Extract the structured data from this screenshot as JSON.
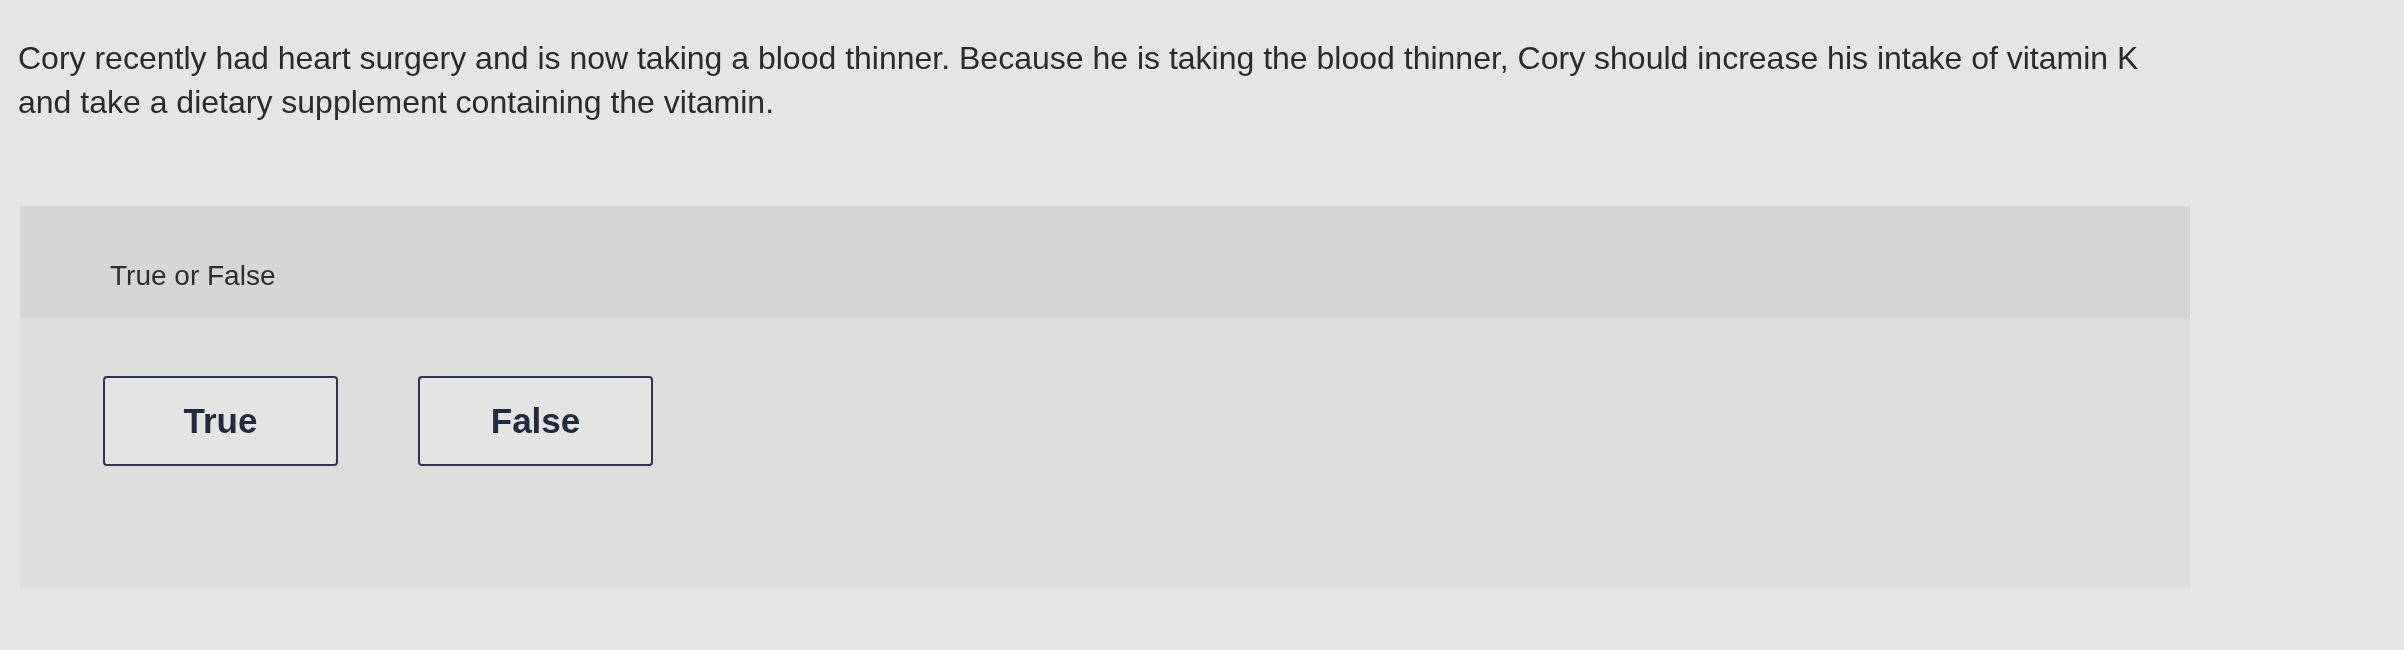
{
  "question": {
    "text": "Cory recently had heart surgery and is now taking a blood thinner. Because he is taking the blood thinner, Cory should increase his intake of vitamin K and take a dietary supplement containing the vitamin."
  },
  "answer_panel": {
    "prompt": "True or False",
    "choices": [
      {
        "label": "True"
      },
      {
        "label": "False"
      }
    ]
  }
}
